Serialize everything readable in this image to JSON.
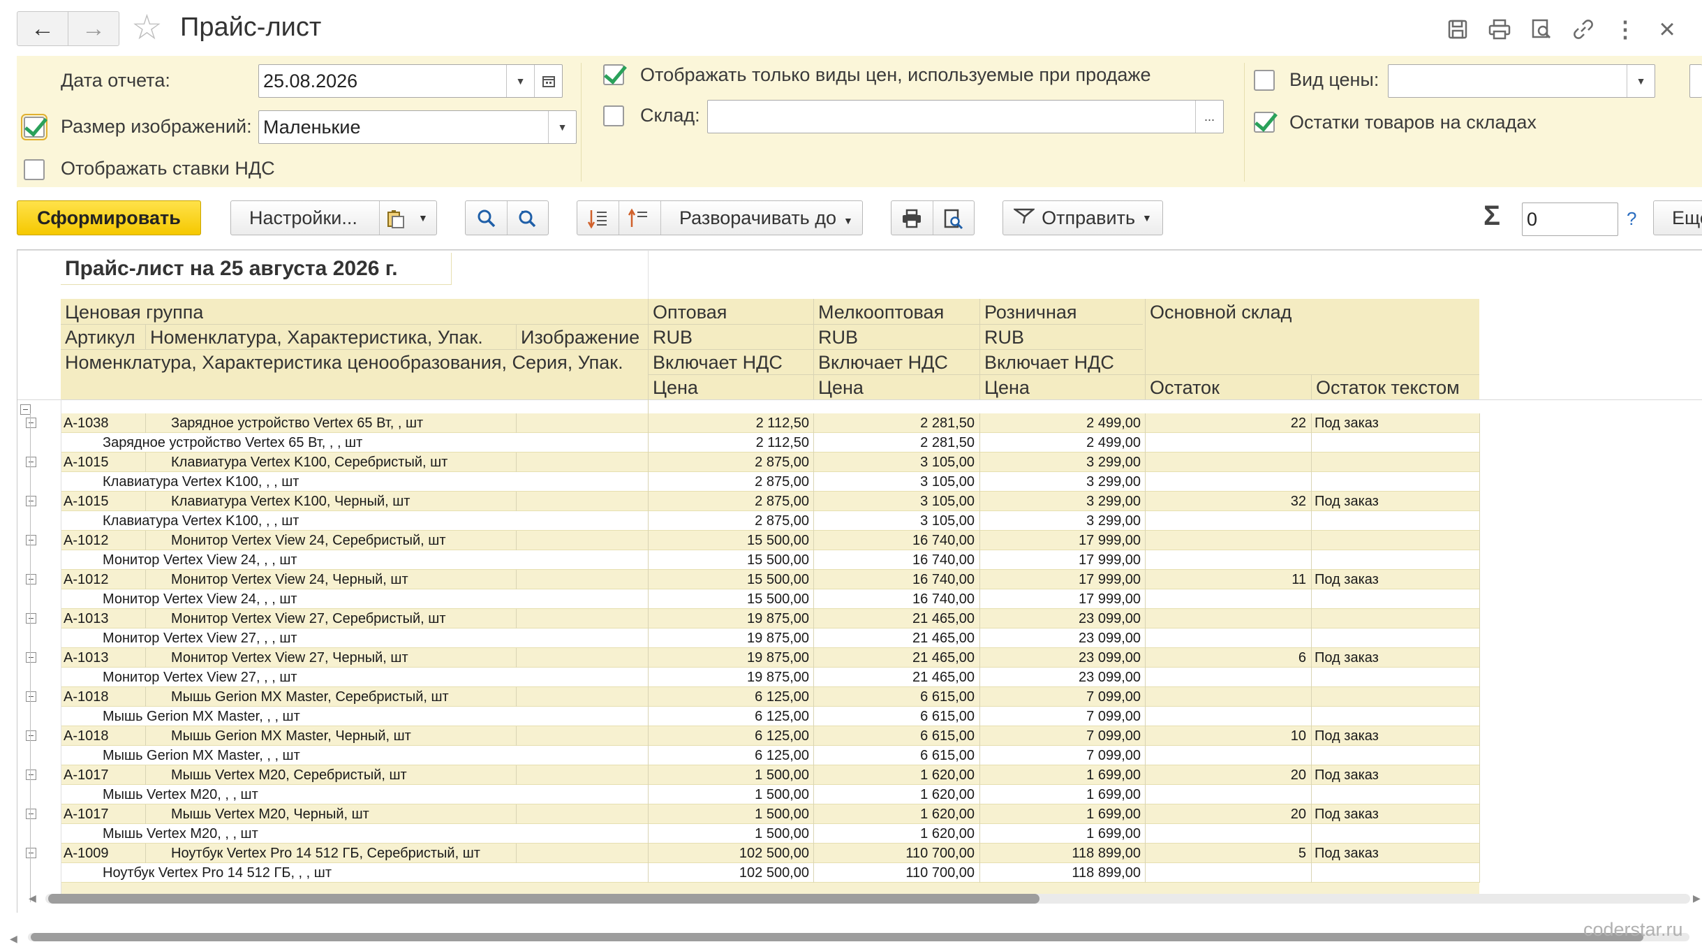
{
  "window": {
    "title": "Прайс-лист",
    "back_icon": "←",
    "forward_icon": "→",
    "star_icon": "☆",
    "close_icon": "×",
    "more_icon": "⋮"
  },
  "params": {
    "date_label": "Дата отчета:",
    "date_value": "25.08.2026",
    "image_size_label": "Размер изображений:",
    "image_size_value": "Маленькие",
    "vat_label": "Отображать ставки НДС",
    "price_kinds_label": "Отображать только виды цен, используемые при продаже",
    "warehouse_label": "Склад:",
    "warehouse_value": "",
    "warehouse_picker": "...",
    "price_kind_label": "Вид цены:",
    "price_kind_value": "",
    "stock_label": "Остатки товаров на складах"
  },
  "toolbar": {
    "generate": "Сформировать",
    "settings": "Настройки...",
    "expand": "Разворачивать до",
    "send": "Отправить",
    "sigma": "Σ",
    "sum_value": "0",
    "help": "?",
    "more": "Еще"
  },
  "report": {
    "title": "Прайс-лист на 25 августа 2026 г.",
    "hdr": {
      "price_group": "Ценовая группа",
      "article": "Артикул",
      "nomenclature": "Номенклатура, Характеристика, Упак.",
      "image": "Изображение",
      "nomenclature2": "Номенклатура, Характеристика ценообразования, Серия, Упак.",
      "wholesale": "Оптовая",
      "small_wholesale": "Мелкооптовая",
      "retail": "Розничная",
      "currency": "RUB",
      "vat": "Включает НДС",
      "price": "Цена",
      "main_wh": "Основной склад",
      "stock": "Остаток",
      "stock_text": "Остаток текстом"
    },
    "rows": [
      {
        "art": "A-1038",
        "name": "Зарядное устройство Vertex 65 Вт, , шт",
        "sub": "Зарядное устройство Vertex 65 Вт, , , шт",
        "p1": "2 112,50",
        "p2": "2 281,50",
        "p3": "2 499,00",
        "qty": "22",
        "qtext": "Под заказ"
      },
      {
        "art": "A-1015",
        "name": "Клавиатура Vertex K100, Серебристый, шт",
        "sub": "Клавиатура Vertex K100, , , шт",
        "p1": "2 875,00",
        "p2": "3 105,00",
        "p3": "3 299,00",
        "qty": "",
        "qtext": ""
      },
      {
        "art": "A-1015",
        "name": "Клавиатура Vertex K100, Черный, шт",
        "sub": "Клавиатура Vertex K100, , , шт",
        "p1": "2 875,00",
        "p2": "3 105,00",
        "p3": "3 299,00",
        "qty": "32",
        "qtext": "Под заказ"
      },
      {
        "art": "A-1012",
        "name": "Монитор Vertex View 24, Серебристый, шт",
        "sub": "Монитор Vertex View 24, , , шт",
        "p1": "15 500,00",
        "p2": "16 740,00",
        "p3": "17 999,00",
        "qty": "",
        "qtext": ""
      },
      {
        "art": "A-1012",
        "name": "Монитор Vertex View 24, Черный, шт",
        "sub": "Монитор Vertex View 24, , , шт",
        "p1": "15 500,00",
        "p2": "16 740,00",
        "p3": "17 999,00",
        "qty": "11",
        "qtext": "Под заказ"
      },
      {
        "art": "A-1013",
        "name": "Монитор Vertex View 27, Серебристый, шт",
        "sub": "Монитор Vertex View 27, , , шт",
        "p1": "19 875,00",
        "p2": "21 465,00",
        "p3": "23 099,00",
        "qty": "",
        "qtext": ""
      },
      {
        "art": "A-1013",
        "name": "Монитор Vertex View 27, Черный, шт",
        "sub": "Монитор Vertex View 27, , , шт",
        "p1": "19 875,00",
        "p2": "21 465,00",
        "p3": "23 099,00",
        "qty": "6",
        "qtext": "Под заказ"
      },
      {
        "art": "A-1018",
        "name": "Мышь Gerion MX Master, Серебристый, шт",
        "sub": "Мышь Gerion MX Master, , , шт",
        "p1": "6 125,00",
        "p2": "6 615,00",
        "p3": "7 099,00",
        "qty": "",
        "qtext": ""
      },
      {
        "art": "A-1018",
        "name": "Мышь Gerion MX Master, Черный, шт",
        "sub": "Мышь Gerion MX Master, , , шт",
        "p1": "6 125,00",
        "p2": "6 615,00",
        "p3": "7 099,00",
        "qty": "10",
        "qtext": "Под заказ"
      },
      {
        "art": "A-1017",
        "name": "Мышь Vertex M20, Серебристый, шт",
        "sub": "Мышь Vertex M20, , , шт",
        "p1": "1 500,00",
        "p2": "1 620,00",
        "p3": "1 699,00",
        "qty": "20",
        "qtext": "Под заказ"
      },
      {
        "art": "A-1017",
        "name": "Мышь Vertex M20, Черный, шт",
        "sub": "Мышь Vertex M20, , , шт",
        "p1": "1 500,00",
        "p2": "1 620,00",
        "p3": "1 699,00",
        "qty": "20",
        "qtext": "Под заказ"
      },
      {
        "art": "A-1009",
        "name": "Ноутбук Vertex Pro 14 512 ГБ, Серебристый, шт",
        "sub": "Ноутбук Vertex Pro 14 512 ГБ, , , шт",
        "p1": "102 500,00",
        "p2": "110 700,00",
        "p3": "118 899,00",
        "qty": "5",
        "qtext": "Под заказ"
      }
    ]
  },
  "watermark": "coderstar.ru",
  "colors": {
    "panel_bg": "#fbf6d9",
    "header_bg": "#f4ecc2",
    "group_row_bg": "#f7f1d0",
    "primary_button": "#f5c800",
    "check_green": "#2aa15a"
  }
}
